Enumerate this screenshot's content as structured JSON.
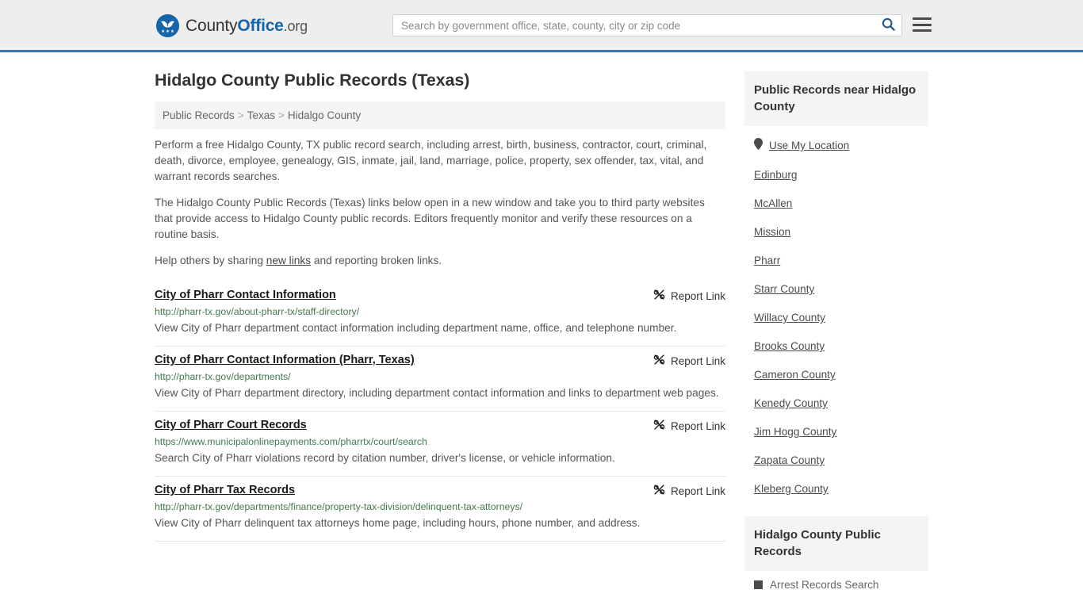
{
  "header": {
    "brand": {
      "part1": "County",
      "part2": "Office",
      "part3": ".org",
      "logo_icon": "eagle-stars-logo-icon"
    },
    "search": {
      "placeholder": "Search by government office, state, county, city or zip code",
      "value": "",
      "search_icon": "search-icon"
    },
    "menu_icon": "hamburger-menu-icon"
  },
  "main": {
    "title": "Hidalgo County Public Records (Texas)",
    "breadcrumb": [
      {
        "label": "Public Records"
      },
      {
        "label": "Texas"
      },
      {
        "label": "Hidalgo County"
      }
    ],
    "breadcrumb_separator": ">",
    "intro": {
      "p1": "Perform a free Hidalgo County, TX public record search, including arrest, birth, business, contractor, court, criminal, death, divorce, employee, genealogy, GIS, inmate, jail, land, marriage, police, property, sex offender, tax, vital, and warrant records searches.",
      "p2": "The Hidalgo County Public Records (Texas) links below open in a new window and take you to third party websites that provide access to Hidalgo County public records. Editors frequently monitor and verify these resources on a routine basis.",
      "p3_before": "Help others by sharing ",
      "p3_link": "new links",
      "p3_after": " and reporting broken links."
    },
    "report_link_label": "Report Link",
    "report_link_icon": "broken-link-icon",
    "listings": [
      {
        "title": "City of Pharr Contact Information",
        "url": "http://pharr-tx.gov/about-pharr-tx/staff-directory/",
        "description": "View City of Pharr department contact information including department name, office, and telephone number."
      },
      {
        "title": "City of Pharr Contact Information (Pharr, Texas)",
        "url": "http://pharr-tx.gov/departments/",
        "description": "View City of Pharr department directory, including department contact information and links to department web pages."
      },
      {
        "title": "City of Pharr Court Records",
        "url": "https://www.municipalonlinepayments.com/pharrtx/court/search",
        "description": "Search City of Pharr violations record by citation number, driver's license, or vehicle information."
      },
      {
        "title": "City of Pharr Tax Records",
        "url": "http://pharr-tx.gov/departments/finance/property-tax-division/delinquent-tax-attorneys/",
        "description": "View City of Pharr delinquent tax attorneys home page, including hours, phone number, and address."
      }
    ]
  },
  "sidebar": {
    "near_box": {
      "title": "Public Records near Hidalgo County",
      "use_my_location": {
        "label": "Use My Location",
        "icon": "location-pin-icon"
      },
      "places": [
        {
          "label": "Edinburg"
        },
        {
          "label": "McAllen"
        },
        {
          "label": "Mission"
        },
        {
          "label": "Pharr"
        },
        {
          "label": "Starr County"
        },
        {
          "label": "Willacy County"
        },
        {
          "label": "Brooks County"
        },
        {
          "label": "Cameron County"
        },
        {
          "label": "Kenedy County"
        },
        {
          "label": "Jim Hogg County"
        },
        {
          "label": "Zapata County"
        },
        {
          "label": "Kleberg County"
        }
      ]
    },
    "records_box": {
      "title": "Hidalgo County Public Records",
      "items": [
        {
          "label": "Arrest Records Search",
          "icon": "square-bullet-icon"
        }
      ]
    }
  },
  "colors": {
    "brand_blue": "#1565a8",
    "header_bg": "#eeeeec",
    "header_border": "#3a79ad",
    "url_green": "#3f7a4d",
    "panel_gray": "#f4f4f4"
  }
}
